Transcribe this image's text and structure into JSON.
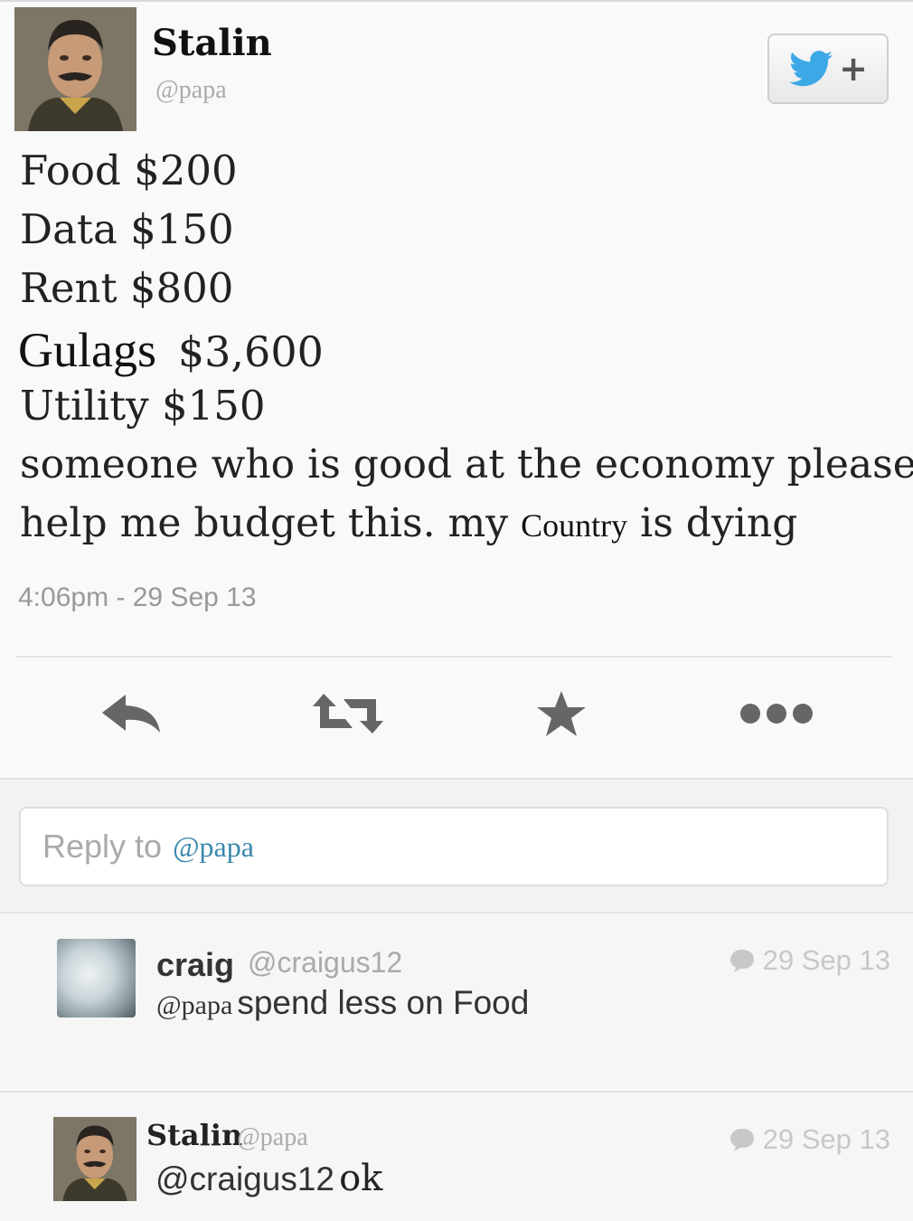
{
  "tweet": {
    "author_name": "Stalin",
    "author_handle": "@papa",
    "lines": [
      {
        "label": "Food",
        "amount": "$200"
      },
      {
        "label": "Data",
        "amount": "$150"
      },
      {
        "label": "Rent",
        "amount": "$800"
      },
      {
        "label": "Gulags",
        "amount": "$3,600"
      },
      {
        "label": "Utility",
        "amount": "$150"
      }
    ],
    "message_line1": "someone who is good at the economy please",
    "message_line2_a": "help me budget this. my",
    "message_line2_b": "Country",
    "message_line2_c": "is dying",
    "timestamp": "4:06pm - 29 Sep 13"
  },
  "follow_button": {
    "icon": "twitter-bird-icon",
    "plus": "+"
  },
  "actions": [
    "reply-icon",
    "retweet-icon",
    "favorite-star-icon",
    "more-dots-icon"
  ],
  "reply_box": {
    "prefix": "Reply to",
    "mention": "@papa"
  },
  "replies": [
    {
      "name": "craig",
      "handle": "@craigus12",
      "date": "29 Sep 13",
      "mention": "@papa",
      "text": "spend less on Food"
    },
    {
      "name": "Stalin",
      "handle": "@papa",
      "date": "29 Sep 13",
      "mention": "@craigus12",
      "text": "ok"
    }
  ],
  "colors": {
    "twitter_blue": "#3ca9e6",
    "mention_blue": "#3a87ad",
    "muted": "#aaaaaa"
  }
}
